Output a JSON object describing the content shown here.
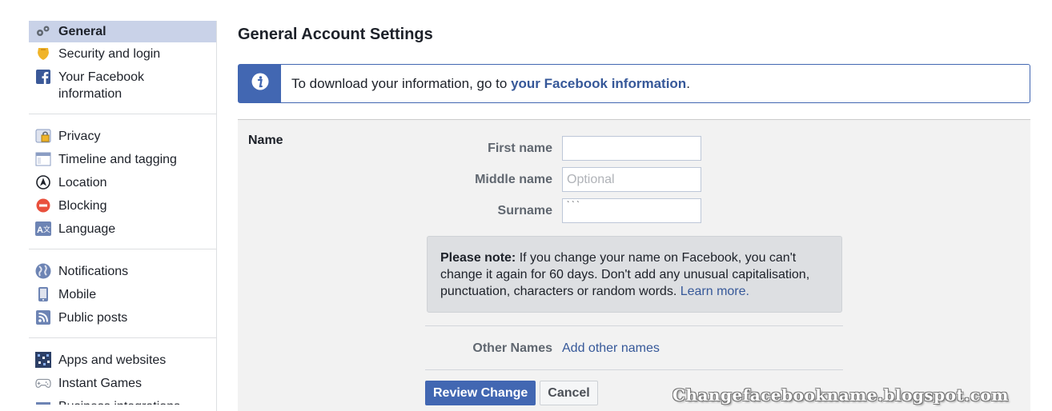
{
  "sidebar": {
    "groups": [
      [
        {
          "label": "General",
          "icon": "gears-icon"
        },
        {
          "label": "Security and login",
          "icon": "shield-icon"
        },
        {
          "label": "Your Facebook information",
          "icon": "facebook-icon"
        }
      ],
      [
        {
          "label": "Privacy",
          "icon": "lock-icon"
        },
        {
          "label": "Timeline and tagging",
          "icon": "timeline-icon"
        },
        {
          "label": "Location",
          "icon": "location-icon"
        },
        {
          "label": "Blocking",
          "icon": "blocking-icon"
        },
        {
          "label": "Language",
          "icon": "language-icon"
        }
      ],
      [
        {
          "label": "Notifications",
          "icon": "globe-icon"
        },
        {
          "label": "Mobile",
          "icon": "mobile-icon"
        },
        {
          "label": "Public posts",
          "icon": "rss-icon"
        }
      ],
      [
        {
          "label": "Apps and websites",
          "icon": "apps-icon"
        },
        {
          "label": "Instant Games",
          "icon": "gamepad-icon"
        },
        {
          "label": "Business integrations",
          "icon": "business-icon"
        }
      ]
    ]
  },
  "main": {
    "title": "General Account Settings",
    "info": {
      "prefix": "To download your information, go to ",
      "link": "your Facebook information",
      "suffix": "."
    },
    "name_section": {
      "label": "Name",
      "first_name_label": "First name",
      "first_name_value": "",
      "middle_name_label": "Middle name",
      "middle_name_placeholder": "Optional",
      "surname_label": "Surname",
      "surname_value": "` ` `",
      "note_bold": "Please note:",
      "note_text": " If you change your name on Facebook, you can't change it again for 60 days. Don't add any unusual capitalisation, punctuation, characters or random words. ",
      "note_link": "Learn more.",
      "other_names_label": "Other Names",
      "other_names_link": "Add other names",
      "review_button": "Review Change",
      "cancel_button": "Cancel"
    }
  },
  "watermark": "Changefacebookname.blogspot.com",
  "colors": {
    "accent": "#4267b2",
    "link": "#365899",
    "active_bg": "#c9d2e8"
  }
}
